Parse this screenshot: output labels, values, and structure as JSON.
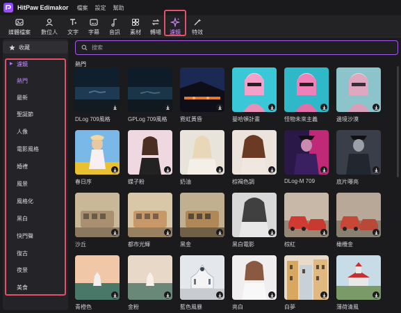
{
  "app": {
    "title": "HitPaw Edimakor"
  },
  "menu": [
    "檔案",
    "設定",
    "幫助"
  ],
  "toolbar": {
    "items": [
      {
        "label": "媒體檔案",
        "icon": "media-icon"
      },
      {
        "label": "數位人",
        "icon": "avatar-icon"
      },
      {
        "label": "文字",
        "icon": "text-icon"
      },
      {
        "label": "字幕",
        "icon": "subtitle-icon"
      },
      {
        "label": "音訊",
        "icon": "audio-icon"
      },
      {
        "label": "素材",
        "icon": "sticker-icon"
      },
      {
        "label": "轉場",
        "icon": "transition-icon"
      },
      {
        "label": "濾鏡",
        "icon": "filter-icon"
      },
      {
        "label": "特效",
        "icon": "effects-icon"
      }
    ],
    "active": "濾鏡"
  },
  "sidebar": {
    "favorites": "收藏",
    "section": "濾鏡",
    "categories": [
      "熱門",
      "最新",
      "聖誕節",
      "人像",
      "電影風格",
      "婚禮",
      "風景",
      "風格化",
      "黑白",
      "快門聲",
      "復古",
      "夜景",
      "美食"
    ],
    "selected": "熱門"
  },
  "search": {
    "placeholder": "搜索"
  },
  "main": {
    "section_title": "熱門",
    "filters": [
      "DLog 709風格",
      "GPLog 709風格",
      "霓虹黃昏",
      "曼哈頓計畫",
      "怪物未來主義",
      "邊境沙漠",
      "春日序",
      "蝶子粉",
      "奶油",
      "棕褐色調",
      "DLog-M 709",
      "底片曝亮",
      "沙丘",
      "都市光輝",
      "黑金",
      "黑白電影",
      "棕紅",
      "橄欖金",
      "青橙色",
      "金粉",
      "藍色風暴",
      "亮白",
      "白夢",
      "薄荷清風"
    ]
  },
  "colors": {
    "accent": "#c88bff",
    "highlight_box": "#e6506a",
    "background": "#1b1b1e"
  }
}
